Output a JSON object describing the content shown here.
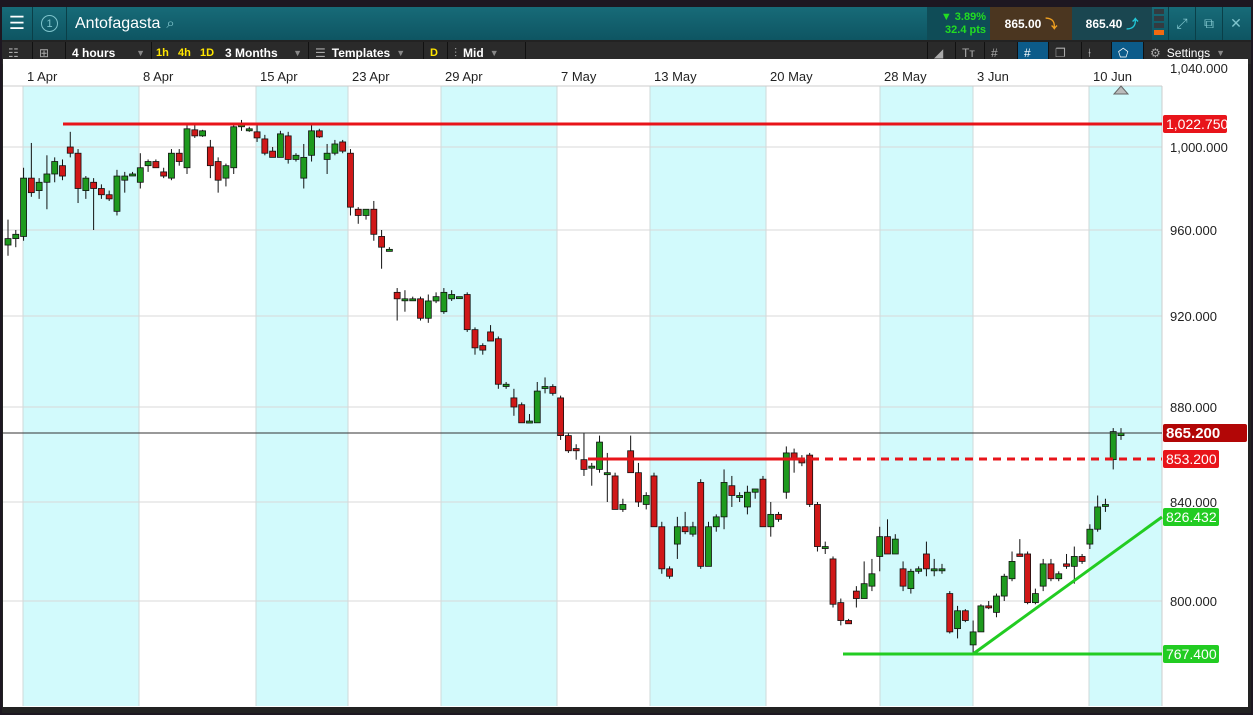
{
  "header": {
    "instrument": "Antofagasta",
    "menu_icon": "hamburger-icon",
    "watchlist_number": "1",
    "change_pct": "▼ 3.89%",
    "change_pts": "32.4 pts",
    "sell_price": "865.00",
    "buy_price": "865.40",
    "colors": {
      "change": "#22dd22",
      "sell_bg": "#4b3620",
      "buy_bg": "#1a4650"
    }
  },
  "toolbar": {
    "interval": "4 hours",
    "quick_intervals": [
      "1h",
      "4h",
      "1D"
    ],
    "range": "3 Months",
    "templates": "Templates",
    "d_button": "D",
    "price_type": "Mid",
    "settings": "Settings"
  },
  "chart_data": {
    "type": "candlestick",
    "x_tick_labels": [
      "1 Apr",
      "8 Apr",
      "15 Apr",
      "23 Apr",
      "29 Apr",
      "7 May",
      "13 May",
      "20 May",
      "28 May",
      "3 Jun",
      "10 Jun"
    ],
    "y_tick_labels": [
      "1,040.000",
      "1,000.000",
      "960.000",
      "920.000",
      "880.000",
      "840.000",
      "800.000"
    ],
    "y_ticks": [
      1040,
      1000,
      960,
      920,
      880,
      840,
      800
    ],
    "grid": true,
    "colors": {
      "up": "#1e9a1e",
      "down": "#d01818",
      "band": "#d2fafc"
    },
    "current_price": {
      "value": 865.2,
      "label": "865.200"
    },
    "annotations": [
      {
        "kind": "horizontal",
        "value": 1022.75,
        "label": "1,022.750",
        "color": "#e8141a",
        "style": "solid"
      },
      {
        "kind": "horizontal",
        "value": 853.2,
        "label": "853.200",
        "color": "#e8141a",
        "style": "solid-then-dashed"
      },
      {
        "kind": "trendline",
        "from": 767.4,
        "to": 826.432,
        "label": "826.432",
        "color": "#22cc22"
      },
      {
        "kind": "horizontal",
        "value": 767.4,
        "label": "767.400",
        "color": "#22cc22",
        "style": "solid"
      }
    ],
    "candles": [
      [
        953,
        965,
        948,
        956
      ],
      [
        956,
        960,
        952,
        958
      ],
      [
        957,
        990,
        955,
        985
      ],
      [
        985,
        1004,
        976,
        978
      ],
      [
        979,
        985,
        975,
        983
      ],
      [
        983,
        996,
        970,
        987
      ],
      [
        987,
        995,
        983,
        993
      ],
      [
        991,
        994,
        984,
        986
      ],
      [
        1000,
        1015,
        995,
        997
      ],
      [
        997,
        999,
        973,
        980
      ],
      [
        979,
        986,
        975,
        985
      ],
      [
        983,
        985,
        960,
        980
      ],
      [
        980,
        982,
        975,
        977
      ],
      [
        977,
        979,
        974,
        975
      ],
      [
        969,
        989,
        967,
        986
      ],
      [
        984,
        988,
        978,
        986
      ],
      [
        987,
        988,
        986,
        987
      ],
      [
        983,
        997,
        980,
        990
      ],
      [
        991,
        994,
        988,
        993
      ],
      [
        993,
        994,
        990,
        990
      ],
      [
        988,
        990,
        985,
        986
      ],
      [
        985,
        999,
        984,
        997
      ],
      [
        997,
        999,
        991,
        993
      ],
      [
        990,
        1022,
        987,
        1018
      ],
      [
        1017,
        1022,
        1009,
        1011
      ],
      [
        1011,
        1017,
        1010,
        1016
      ],
      [
        1000,
        1007,
        985,
        991
      ],
      [
        993,
        995,
        978,
        984
      ],
      [
        985,
        992,
        981,
        991
      ],
      [
        990,
        1022,
        987,
        1020
      ],
      [
        1021,
        1024,
        1016,
        1022
      ],
      [
        1018,
        1020,
        1015,
        1018
      ],
      [
        1015,
        1022,
        1005,
        1009
      ],
      [
        1008,
        1012,
        996,
        997
      ],
      [
        998,
        1000,
        995,
        995
      ],
      [
        995,
        1016,
        995,
        1013
      ],
      [
        1011,
        1015,
        992,
        994
      ],
      [
        994,
        997,
        993,
        996
      ],
      [
        985,
        1003,
        980,
        995
      ],
      [
        996,
        1022,
        993,
        1016
      ],
      [
        1016,
        1018,
        1009,
        1010
      ],
      [
        994,
        1003,
        987,
        997
      ],
      [
        997,
        1007,
        996,
        1003
      ],
      [
        1005,
        1007,
        997,
        998
      ],
      [
        997,
        999,
        967,
        971
      ],
      [
        970,
        971,
        963,
        967
      ],
      [
        967,
        970,
        965,
        970
      ],
      [
        970,
        974,
        955,
        958
      ],
      [
        957,
        960,
        942,
        952
      ],
      [
        951,
        952,
        950,
        951
      ],
      [
        931,
        933,
        918,
        928
      ],
      [
        928,
        932,
        922,
        928
      ],
      [
        928,
        929,
        927,
        928
      ],
      [
        928,
        929,
        918,
        919
      ],
      [
        919,
        930,
        917,
        927
      ],
      [
        927,
        931,
        926,
        929
      ],
      [
        922,
        933,
        921,
        931
      ],
      [
        928,
        932,
        927,
        930
      ],
      [
        929,
        929,
        928,
        929
      ],
      [
        930,
        931,
        913,
        914
      ],
      [
        914,
        915,
        903,
        906
      ],
      [
        907,
        908,
        903,
        905
      ],
      [
        913,
        916,
        909,
        909
      ],
      [
        910,
        911,
        888,
        890
      ],
      [
        889,
        891,
        888,
        890
      ],
      [
        884,
        888,
        875,
        880
      ],
      [
        881,
        882,
        871,
        871
      ],
      [
        872,
        876,
        871,
        872
      ],
      [
        871,
        891,
        871,
        887
      ],
      [
        889,
        893,
        886,
        889
      ],
      [
        889,
        890,
        885,
        886
      ],
      [
        884,
        885,
        862,
        864
      ],
      [
        864,
        865,
        856,
        857
      ],
      [
        858,
        860,
        853,
        857
      ],
      [
        853,
        865,
        848,
        850
      ],
      [
        851,
        852,
        845,
        851
      ],
      [
        850,
        864,
        849,
        861
      ],
      [
        849,
        856,
        840,
        849
      ],
      [
        848,
        849,
        837,
        837
      ],
      [
        837,
        841,
        836,
        839
      ],
      [
        857,
        864,
        849,
        849
      ],
      [
        849,
        852,
        838,
        840
      ],
      [
        839,
        843,
        837,
        842
      ],
      [
        848,
        849,
        830,
        830
      ],
      [
        830,
        832,
        811,
        813
      ],
      [
        813,
        814,
        809,
        810
      ],
      [
        823,
        834,
        817,
        830
      ],
      [
        830,
        836,
        827,
        828
      ],
      [
        827,
        832,
        826,
        830
      ],
      [
        846,
        847,
        813,
        814
      ],
      [
        814,
        832,
        814,
        830
      ],
      [
        830,
        835,
        828,
        834
      ],
      [
        834,
        850,
        829,
        846
      ],
      [
        845,
        848,
        838,
        842
      ],
      [
        842,
        843,
        840,
        842
      ],
      [
        838,
        845,
        835,
        843
      ],
      [
        843,
        844,
        841,
        844
      ],
      [
        847,
        848,
        830,
        830
      ],
      [
        830,
        840,
        826,
        835
      ],
      [
        835,
        836,
        832,
        833
      ],
      [
        843,
        859,
        841,
        856
      ],
      [
        856,
        858,
        849,
        853
      ],
      [
        853,
        855,
        851,
        852
      ],
      [
        855,
        856,
        838,
        839
      ],
      [
        839,
        840,
        820,
        822
      ],
      [
        822,
        824,
        819,
        822
      ],
      [
        817,
        818,
        796,
        798
      ],
      [
        799,
        801,
        785,
        788
      ],
      [
        788,
        789,
        786,
        786
      ],
      [
        804,
        806,
        796,
        801
      ],
      [
        801,
        816,
        801,
        807
      ],
      [
        806,
        817,
        804,
        811
      ],
      [
        818,
        830,
        812,
        826
      ],
      [
        826,
        833,
        819,
        819
      ],
      [
        819,
        827,
        819,
        825
      ],
      [
        813,
        816,
        804,
        806
      ],
      [
        805,
        813,
        803,
        812
      ],
      [
        812,
        814,
        811,
        813
      ],
      [
        819,
        824,
        810,
        813
      ],
      [
        813,
        817,
        810,
        813
      ],
      [
        813,
        815,
        811,
        813
      ],
      [
        803,
        804,
        780,
        781
      ],
      [
        783,
        797,
        777,
        794
      ],
      [
        794,
        795,
        787,
        788
      ],
      [
        773,
        788,
        767,
        781
      ],
      [
        781,
        798,
        781,
        797
      ],
      [
        797,
        800,
        795,
        796
      ],
      [
        793,
        803,
        790,
        802
      ],
      [
        802,
        811,
        800,
        810
      ],
      [
        809,
        820,
        808,
        816
      ],
      [
        819,
        825,
        818,
        818
      ],
      [
        819,
        820,
        798,
        799
      ],
      [
        799,
        805,
        798,
        803
      ],
      [
        806,
        817,
        804,
        815
      ],
      [
        815,
        817,
        808,
        809
      ],
      [
        809,
        812,
        808,
        811
      ],
      [
        815,
        819,
        813,
        814
      ],
      [
        814,
        822,
        807,
        818
      ],
      [
        818,
        819,
        815,
        816
      ],
      [
        823,
        831,
        821,
        829
      ],
      [
        829,
        842,
        828,
        838
      ],
      [
        839,
        841,
        836,
        839
      ],
      [
        853,
        868,
        850,
        866
      ],
      [
        864,
        868,
        862,
        865.2
      ]
    ]
  }
}
